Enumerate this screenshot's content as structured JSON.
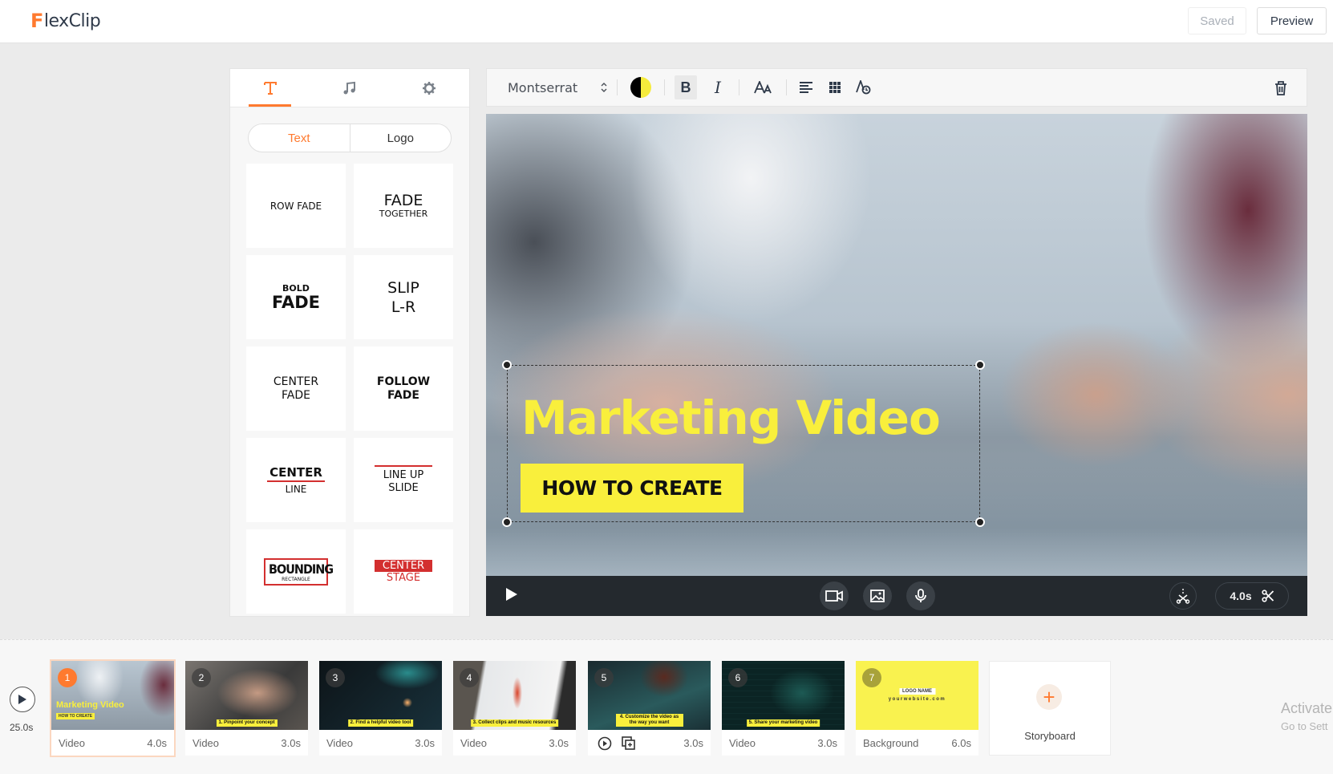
{
  "app": {
    "name": "FlexClip",
    "logo_first": "F",
    "logo_rest": "lexClip"
  },
  "header": {
    "saved_label": "Saved",
    "preview_label": "Preview"
  },
  "left_panel": {
    "tabs": [
      {
        "icon": "text-icon",
        "active": true
      },
      {
        "icon": "music-icon",
        "active": false
      },
      {
        "icon": "gear-icon",
        "active": false
      }
    ],
    "segments": [
      "Text",
      "Logo"
    ],
    "active_segment": "Text",
    "templates": [
      {
        "name": "row-fade",
        "lines": [
          "ROW FADE"
        ]
      },
      {
        "name": "fade-together",
        "lines": [
          "FADE",
          "TOGETHER"
        ]
      },
      {
        "name": "bold-fade",
        "lines": [
          "BOLD",
          "FADE"
        ]
      },
      {
        "name": "slip-lr",
        "lines": [
          "SLIP",
          "L-R"
        ]
      },
      {
        "name": "center-fade",
        "lines": [
          "CENTER",
          "FADE"
        ]
      },
      {
        "name": "follow-fade",
        "lines": [
          "FOLLOW",
          "FADE"
        ]
      },
      {
        "name": "center-line",
        "lines": [
          "CENTER",
          "LINE"
        ]
      },
      {
        "name": "line-up-slide",
        "lines": [
          "LINE UP",
          "SLIDE"
        ]
      },
      {
        "name": "bounding-rectangle",
        "lines": [
          "BOUNDING",
          "RECTANGLE"
        ]
      },
      {
        "name": "center-stage",
        "lines": [
          "CENTER",
          "STAGE"
        ]
      }
    ]
  },
  "toolbar": {
    "font": "Montserrat",
    "color_contrast": {
      "left": "#000000",
      "right": "#f5eb3c"
    },
    "bold_label": "B",
    "italic_label": "I",
    "size_label": "AA",
    "bold_active": true
  },
  "canvas": {
    "headline": "Marketing Video",
    "subtitle": "HOW TO CREATE",
    "accent_color": "#f9ef3c"
  },
  "video_controls": {
    "duration": "4.0s"
  },
  "timeline": {
    "total_duration": "25.0s",
    "clips": [
      {
        "num": "1",
        "type": "Video",
        "duration": "4.0s",
        "caption": "",
        "active": true
      },
      {
        "num": "2",
        "type": "Video",
        "duration": "3.0s",
        "caption": "1. Pinpoint your concept"
      },
      {
        "num": "3",
        "type": "Video",
        "duration": "3.0s",
        "caption": "2. Find a helpful video tool"
      },
      {
        "num": "4",
        "type": "Video",
        "duration": "3.0s",
        "caption": "3. Collect clips and music resources"
      },
      {
        "num": "5",
        "type": "",
        "duration": "3.0s",
        "caption": "4. Customize the video as the way you want"
      },
      {
        "num": "6",
        "type": "Video",
        "duration": "3.0s",
        "caption": "5. Share your marketing video"
      },
      {
        "num": "7",
        "type": "Background",
        "duration": "6.0s",
        "caption": ""
      }
    ],
    "clip1_mini": {
      "title": "Marketing Video",
      "sub": "HOW TO CREATE"
    },
    "clip7": {
      "logo": "LOGO NAME",
      "site": "yourwebsite.com"
    },
    "storyboard_label": "Storyboard"
  },
  "os_watermark": {
    "line1": "Activate",
    "line2": "Go to Sett"
  }
}
